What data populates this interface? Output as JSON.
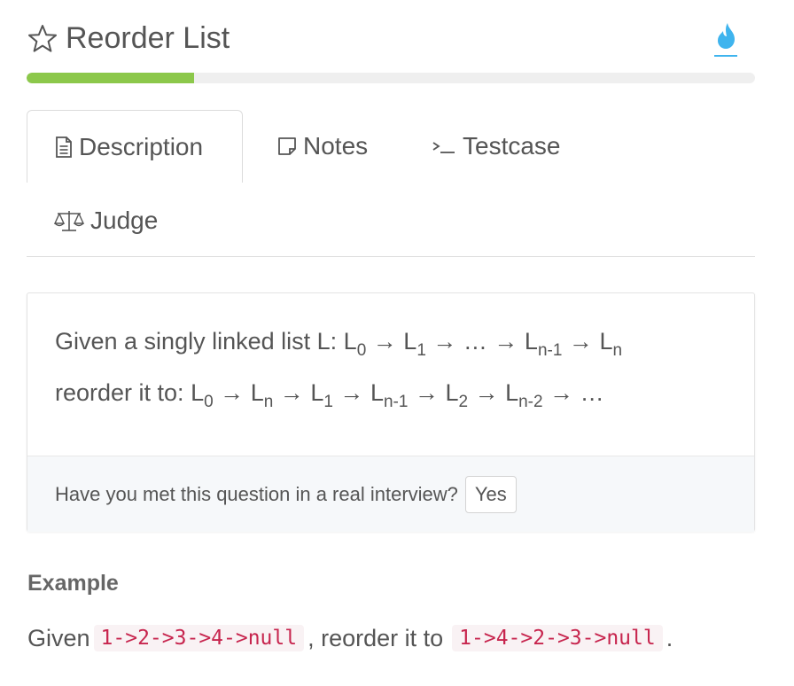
{
  "header": {
    "title": "Reorder List",
    "star_icon": "star-outline-icon",
    "flame_icon": "flame-icon",
    "accent": "#3fb4ee"
  },
  "progress": {
    "percent": 23,
    "color": "#8cc84b"
  },
  "tabs": [
    {
      "label": "Description",
      "icon": "document-icon",
      "active": true
    },
    {
      "label": "Notes",
      "icon": "note-icon",
      "active": false
    },
    {
      "label": "Testcase",
      "icon": "terminal-icon",
      "active": false
    },
    {
      "label": "Judge",
      "icon": "scale-icon",
      "active": false
    }
  ],
  "problem": {
    "line1_prefix": "Given a singly linked list L: ",
    "line2_prefix": "reorder it to: ",
    "line1_terms": [
      {
        "base": "L",
        "sub": "0"
      },
      {
        "base": "L",
        "sub": "1"
      },
      {
        "base": "…",
        "sub": ""
      },
      {
        "base": "L",
        "sub": "n-1"
      },
      {
        "base": "L",
        "sub": "n"
      }
    ],
    "line2_terms": [
      {
        "base": "L",
        "sub": "0"
      },
      {
        "base": "L",
        "sub": "n"
      },
      {
        "base": "L",
        "sub": "1"
      },
      {
        "base": "L",
        "sub": "n-1"
      },
      {
        "base": "L",
        "sub": "2"
      },
      {
        "base": "L",
        "sub": "n-2"
      },
      {
        "base": "…",
        "sub": ""
      }
    ],
    "arrow": "→"
  },
  "interview": {
    "question": "Have you met this question in a real interview?",
    "yes_label": "Yes"
  },
  "example": {
    "heading": "Example",
    "given": "Given",
    "input": "1->2->3->4->null",
    "middle": ", reorder it to",
    "output": "1->4->2->3->null",
    "end": "."
  }
}
